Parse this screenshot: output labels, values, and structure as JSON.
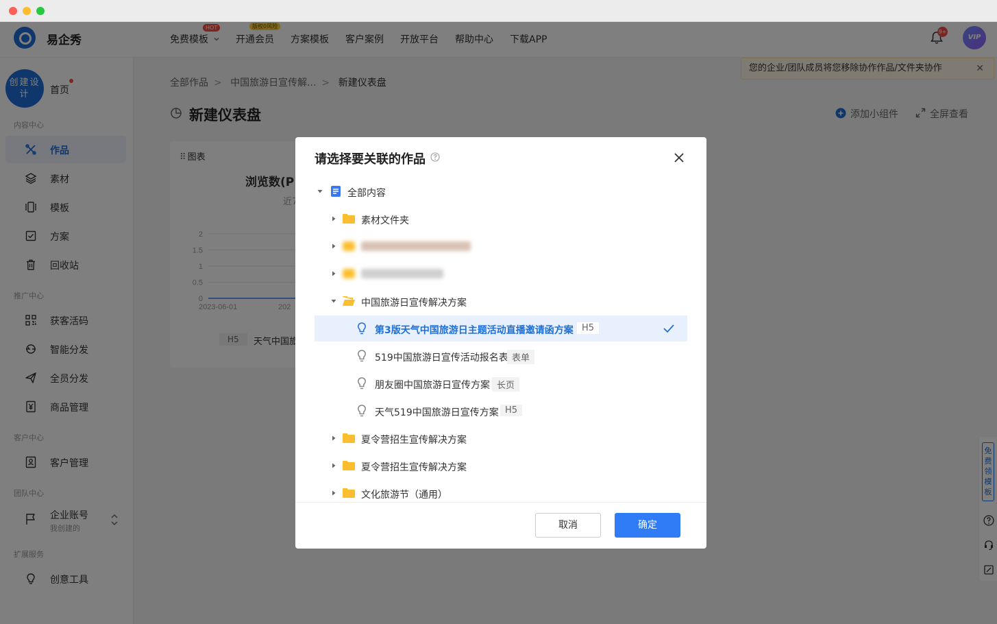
{
  "app": {
    "brand": "易企秀"
  },
  "nav": {
    "items": [
      "免费模板",
      "开通会员",
      "方案模板",
      "客户案例",
      "开放平台",
      "帮助中心",
      "下载APP"
    ],
    "hot_badge": "HOT",
    "risk_badge": "版权0风险",
    "bell_count": "9+",
    "vip_label": "VIP"
  },
  "sidebar": {
    "create_label": "创建设计",
    "home_label": "首页",
    "sections": {
      "content": "内容中心",
      "promote": "推广中心",
      "customer": "客户中心",
      "team": "团队中心",
      "extend": "扩展服务"
    },
    "items": {
      "works": "作品",
      "materials": "素材",
      "templates": "模板",
      "plans": "方案",
      "recycle": "回收站",
      "leads": "获客活码",
      "smart_share": "智能分发",
      "all_share": "全员分发",
      "goods": "商品管理",
      "customers": "客户管理",
      "enterprise": "企业账号",
      "creative": "创意工具"
    },
    "enterprise_sub": "我创建的"
  },
  "main": {
    "breadcrumb": [
      "全部作品",
      "中国旅游日宣传解...",
      "新建仪表盘"
    ],
    "title": "新建仪表盘",
    "add_widget": "添加小组件",
    "fullscreen": "全屏查看",
    "notice": "您的企业/团队成员将您移除协作作品/文件夹协作",
    "notice_close": "✕",
    "card": {
      "header": "图表",
      "chart_title": "浏览数(P",
      "chart_sub": "近7",
      "foot_tag": "H5",
      "foot_text": "天气中国旅"
    },
    "right_float": "免费领模板"
  },
  "chart_data": {
    "type": "line",
    "title": "浏览数(P",
    "yticks": [
      "2",
      "1.5",
      "1",
      "0.5",
      "0"
    ],
    "xticks": [
      "2023-06-01",
      "202"
    ],
    "ylim": [
      0,
      2
    ]
  },
  "modal": {
    "title": "请选择要关联的作品",
    "root": "全部内容",
    "nodes": [
      {
        "label": "素材文件夹"
      },
      {
        "label": ""
      },
      {
        "label": ""
      },
      {
        "label": "中国旅游日宣传解决方案"
      },
      {
        "label": "第3版天气中国旅游日主题活动直播邀请函方案",
        "tag": "H5"
      },
      {
        "label": "519中国旅游日宣传活动报名表",
        "tag": "表单"
      },
      {
        "label": "朋友圈中国旅游日宣传方案",
        "tag": "长页"
      },
      {
        "label": "天气519中国旅游日宣传方案",
        "tag": "H5"
      },
      {
        "label": "夏令营招生宣传解决方案"
      },
      {
        "label": "夏令营招生宣传解决方案"
      },
      {
        "label": "文化旅游节（通用）"
      }
    ],
    "cancel": "取消",
    "confirm": "确定"
  }
}
